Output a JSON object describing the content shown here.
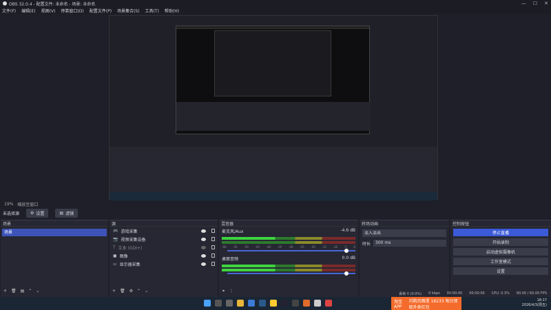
{
  "window": {
    "title": "OBS 32.0.4 - 配置文件: 未命名 - 场景: 未命名",
    "min": "—",
    "max": "☐",
    "close": "✕"
  },
  "menu": [
    "文件(F)",
    "编辑(E)",
    "视图(V)",
    "停靠窗口(D)",
    "配置文件(P)",
    "场景集合(S)",
    "工具(T)",
    "帮助(H)"
  ],
  "zoom": {
    "value": "19%",
    "mode": "缩放至窗口"
  },
  "scene_bar": {
    "label": "未选择源",
    "settings": "设置",
    "filters": "滤镜"
  },
  "scenes": {
    "title": "场景",
    "items": [
      "场景"
    ]
  },
  "sources": {
    "title": "源",
    "items": [
      {
        "icon": "game-icon",
        "name": "游戏采集"
      },
      {
        "icon": "camera-icon",
        "name": "视频采集设备"
      },
      {
        "icon": "text-icon",
        "name": "文本 (GDI+)"
      },
      {
        "icon": "image-icon",
        "name": "图像"
      },
      {
        "icon": "monitor-icon",
        "name": "显示器采集"
      }
    ]
  },
  "mixer": {
    "title": "混音器",
    "channels": [
      {
        "name": "麦克风/Aux",
        "db": "-4.6 dB",
        "level": 0.47
      },
      {
        "name": "桌面音频",
        "db": "0.0 dB",
        "level": 0.49
      }
    ],
    "ticks": [
      "-60",
      "-55",
      "-50",
      "-45",
      "-40",
      "-35",
      "-30",
      "-25",
      "-20",
      "-15",
      "-10",
      "-5",
      "0"
    ]
  },
  "transitions": {
    "title": "转场动画",
    "type": "淡入淡出",
    "duration_label": "时长",
    "duration": "300 ms"
  },
  "controls": {
    "title": "控制按钮",
    "buttons": [
      "停止直播",
      "开始录制",
      "启动虚拟摄像机",
      "工作室模式",
      "设置"
    ]
  },
  "status": {
    "frames": "丢帧 0 (0.0%)",
    "kbps": "0 kbps",
    "stream_time": "00:00:00",
    "rec_time": "00:00:00",
    "cpu": "CPU: 0.3%",
    "fps": "60.00 / 60.00 FPS"
  },
  "taskbar": {
    "promo_brand": "淘宝APP",
    "promo_text": "闪购页面提 18233 每日领取外卖红包",
    "time": "18:17",
    "date": "2026/4/3(周五)"
  },
  "colors": {
    "accent": "#3d53b8",
    "active_button": "#3b5ad8",
    "promo": "#f46b2b"
  }
}
